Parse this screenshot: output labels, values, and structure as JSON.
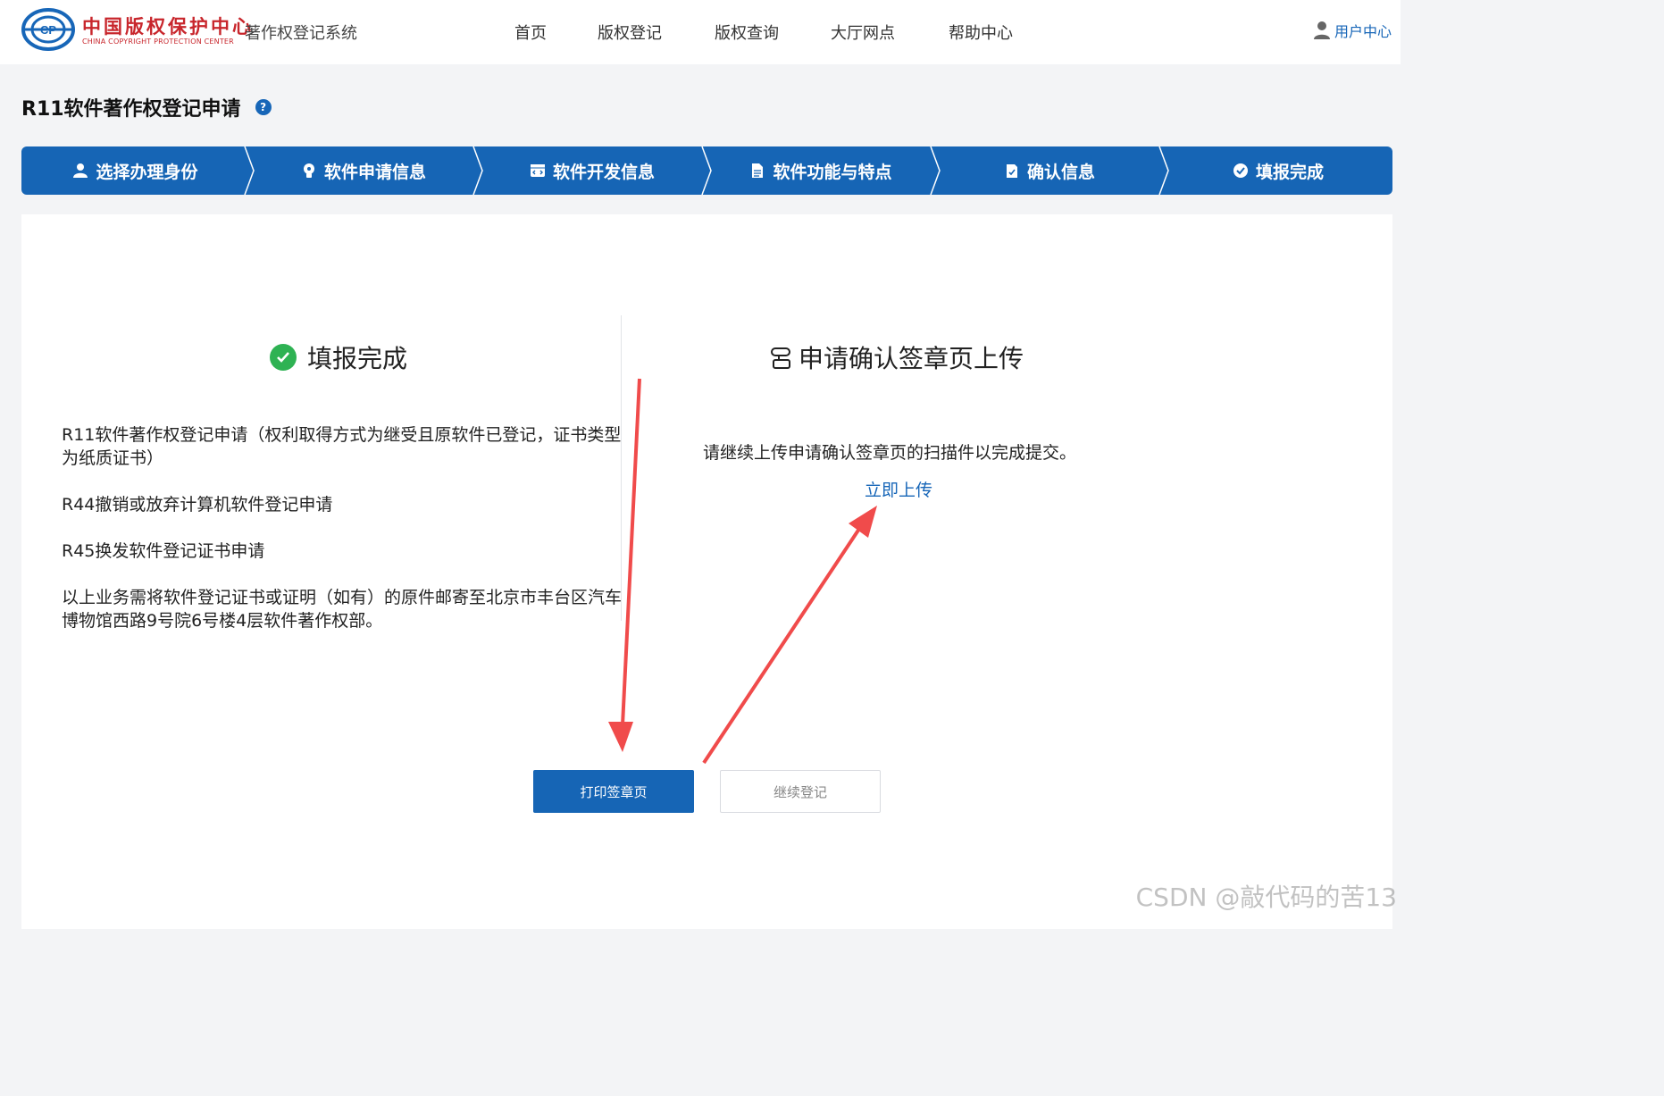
{
  "header": {
    "logo_cn": "中国版权保护中心",
    "logo_en": "CHINA COPYRIGHT PROTECTION CENTER",
    "system_name": "著作权登记系统",
    "nav": [
      "首页",
      "版权登记",
      "版权查询",
      "大厅网点",
      "帮助中心"
    ],
    "user_center": "用户中心"
  },
  "page": {
    "title": "R11软件著作权登记申请"
  },
  "steps": [
    {
      "label": "选择办理身份",
      "icon": "user-icon"
    },
    {
      "label": "软件申请信息",
      "icon": "bulb-icon"
    },
    {
      "label": "软件开发信息",
      "icon": "code-window-icon"
    },
    {
      "label": "软件功能与特点",
      "icon": "document-icon"
    },
    {
      "label": "确认信息",
      "icon": "clipboard-check-icon"
    },
    {
      "label": "填报完成",
      "icon": "check-circle-icon"
    }
  ],
  "left": {
    "title": "填报完成",
    "paragraphs": [
      "R11软件著作权登记申请（权利取得方式为继受且原软件已登记，证书类型为纸质证书）",
      "R44撤销或放弃计算机软件登记申请",
      "R45换发软件登记证书申请",
      "以上业务需将软件登记证书或证明（如有）的原件邮寄至北京市丰台区汽车博物馆西路9号院6号楼4层软件著作权部。"
    ]
  },
  "right": {
    "title": "申请确认签章页上传",
    "description": "请继续上传申请确认签章页的扫描件以完成提交。",
    "upload_link": "立即上传"
  },
  "buttons": {
    "print": "打印签章页",
    "continue": "继续登记"
  },
  "watermark": "CSDN @敲代码的苦13",
  "colors": {
    "primary": "#1665b5",
    "success": "#2eb253",
    "annotation_arrow": "#f04b4b",
    "brand_red": "#c8262c"
  }
}
